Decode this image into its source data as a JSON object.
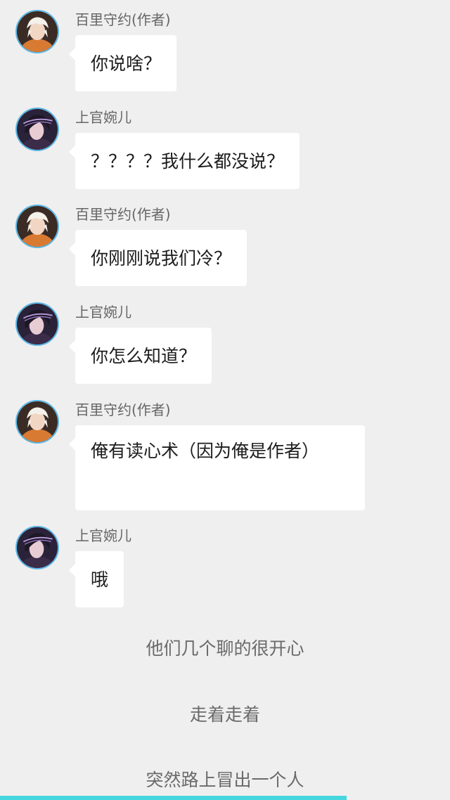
{
  "messages": [
    {
      "sender": "百里守约(作者)",
      "avatar": "male-character-avatar",
      "text": "你说啥？"
    },
    {
      "sender": "上官婉儿",
      "avatar": "female-character-avatar",
      "text": "？？？？我什么都没说？"
    },
    {
      "sender": "百里守约(作者)",
      "avatar": "male-character-avatar",
      "text": "你刚刚说我们冷？"
    },
    {
      "sender": "上官婉儿",
      "avatar": "female-character-avatar",
      "text": "你怎么知道？"
    },
    {
      "sender": "百里守约(作者)",
      "avatar": "male-character-avatar",
      "text": "俺有读心术（因为俺是作者）"
    },
    {
      "sender": "上官婉儿",
      "avatar": "female-character-avatar",
      "text": "哦"
    }
  ],
  "narration": [
    "他们几个聊的很开心",
    "走着走着",
    "突然路上冒出一个人"
  ],
  "reading_progress": 0.77,
  "colors": {
    "background": "#efefef",
    "bubble": "#ffffff",
    "avatar_ring": "#59b6e6",
    "progress": "#46d6de"
  }
}
